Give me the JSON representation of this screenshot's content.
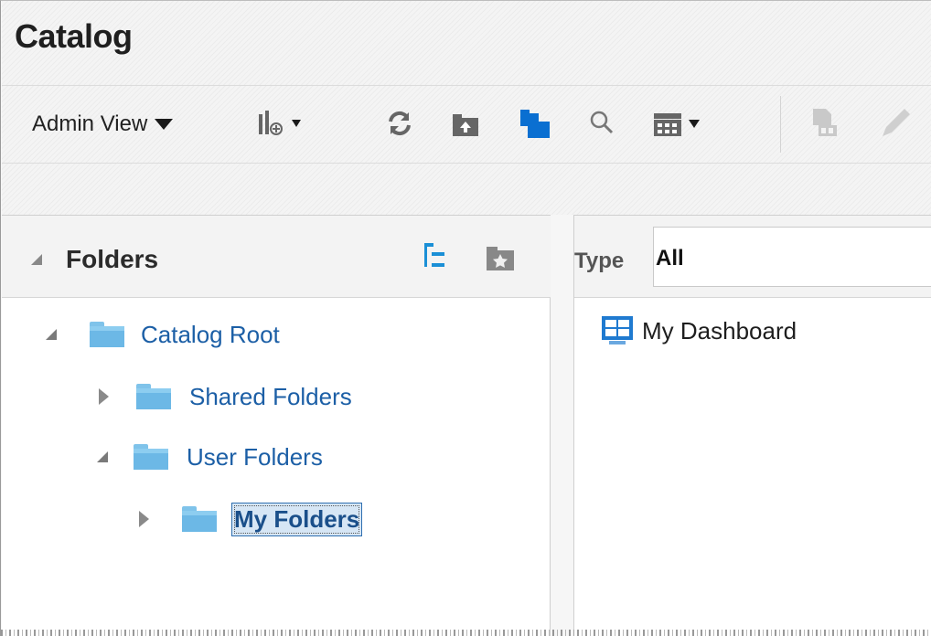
{
  "header": {
    "title": "Catalog"
  },
  "toolbar": {
    "view_label": "Admin View",
    "icons": [
      "add-column-icon",
      "refresh-icon",
      "upload-folder-icon",
      "new-folder-icon",
      "search-icon",
      "grid-view-icon",
      "properties-icon",
      "edit-icon"
    ]
  },
  "folders": {
    "title": "Folders",
    "tree": [
      {
        "label": "Catalog Root",
        "expanded": true
      },
      {
        "label": "Shared Folders",
        "expanded": false
      },
      {
        "label": "User Folders",
        "expanded": true
      },
      {
        "label": "My Folders",
        "expanded": false,
        "selected": true
      }
    ]
  },
  "content": {
    "type_label": "Type",
    "type_value": "All",
    "items": [
      {
        "label": "My Dashboard",
        "icon": "dashboard-icon"
      }
    ]
  },
  "colors": {
    "link": "#1c5fa6",
    "folder": "#6cb8e6",
    "selected_bg": "#d6e6f5",
    "new_folder_icon": "#0a6fd1"
  }
}
